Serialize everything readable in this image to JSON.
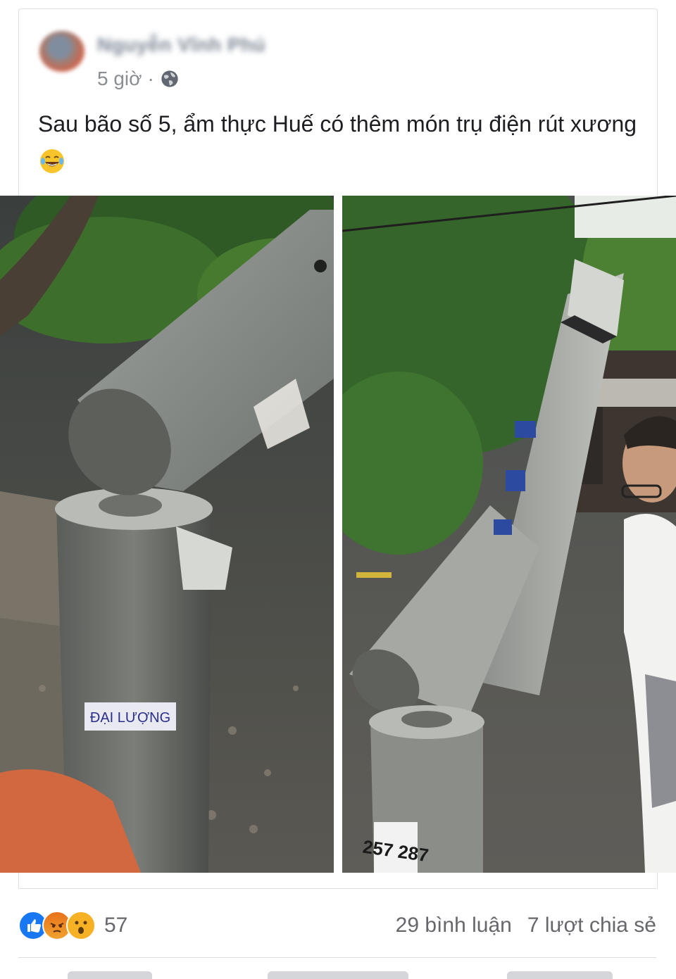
{
  "post": {
    "author": "Nguyễn Vĩnh Phú",
    "time": "5 giờ",
    "separator": "·",
    "privacy_icon": "globe-icon",
    "text": "Sau bão số 5, ẩm thực Huế có thêm món trụ điện rút xương",
    "emoji": "laughing-tears-emoji"
  },
  "photos": {
    "left": {
      "sticker_text": "ĐẠI LƯỢNG"
    },
    "right": {
      "pole_number": "257 287"
    }
  },
  "footer": {
    "reaction_icons": [
      "like-icon",
      "angry-icon",
      "wow-icon"
    ],
    "reaction_count": "57",
    "comments": "29 bình luận",
    "shares": "7 lượt chia sẻ"
  },
  "colors": {
    "accent": "#1877f2",
    "muted": "#65676b"
  }
}
